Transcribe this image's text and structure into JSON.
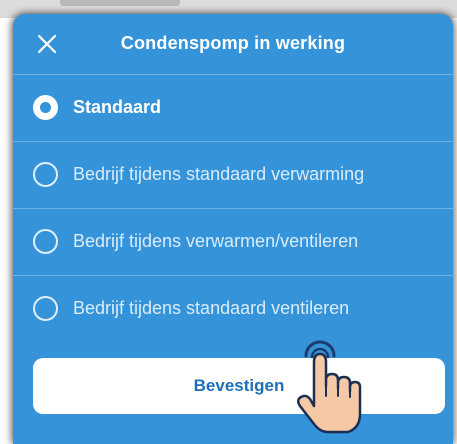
{
  "dialog": {
    "title": "Condenspomp in werking",
    "close_icon": "close-icon",
    "options": [
      {
        "label": "Standaard",
        "selected": true
      },
      {
        "label": "Bedrijf tijdens standaard verwarming",
        "selected": false
      },
      {
        "label": "Bedrijf tijdens verwarmen/ventileren",
        "selected": false
      },
      {
        "label": "Bedrijf tijdens standaard ventileren",
        "selected": false
      }
    ],
    "confirm_label": "Bevestigen"
  },
  "pointer_icon": "tap-hand-icon",
  "colors": {
    "dialog_background": "#3593d9",
    "button_background": "#ffffff",
    "button_text": "#1f6fb8",
    "text": "#ffffff"
  }
}
